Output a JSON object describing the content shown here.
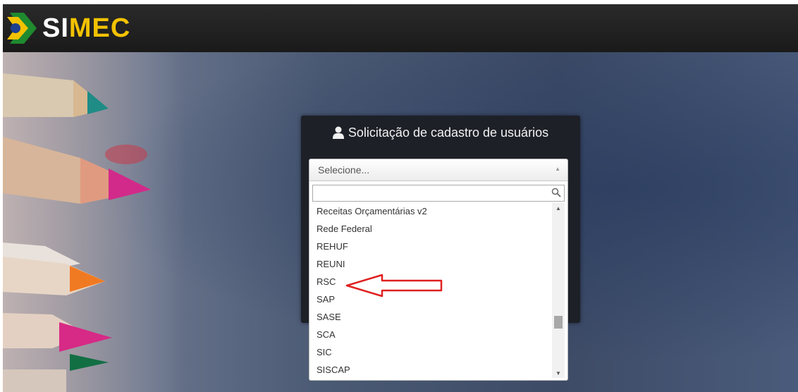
{
  "header": {
    "brand_part1": "SI",
    "brand_part2": "MEC",
    "logo_icon": "brazil-flag-arrow-icon"
  },
  "panel": {
    "title": "Solicitação de cadastro de usuários",
    "icon": "user-icon"
  },
  "select": {
    "selected_label": "Selecione...",
    "search_value": "",
    "search_icon": "search-icon",
    "options": [
      "Receitas Orçamentárias v2",
      "Rede Federal",
      "REHUF",
      "REUNI",
      "RSC",
      "SAP",
      "SASE",
      "SCA",
      "SIC",
      "SISCAP"
    ]
  },
  "annotation": {
    "type": "red-arrow",
    "points_to": "RSC",
    "color": "#e02020"
  }
}
